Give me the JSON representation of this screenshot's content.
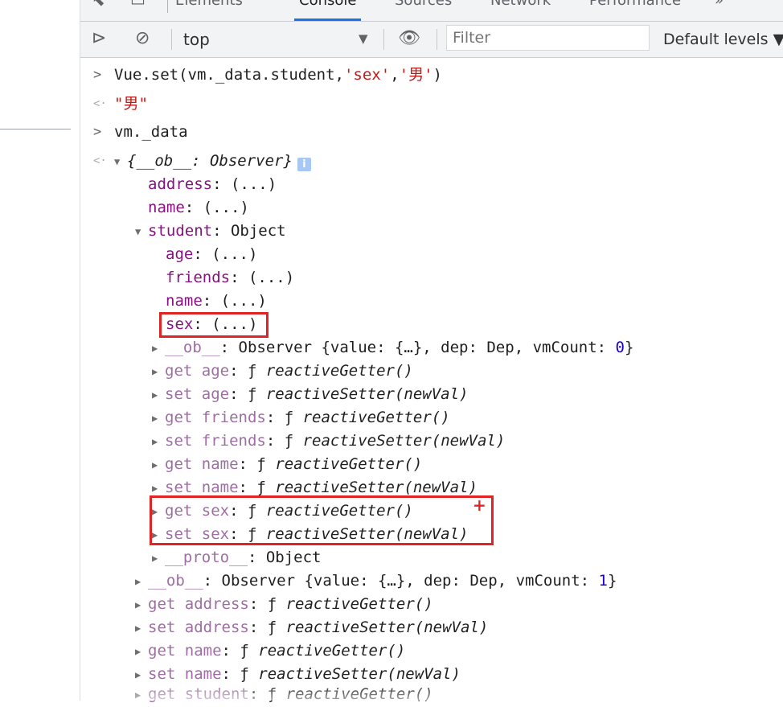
{
  "tabs": [
    {
      "label": "Elements"
    },
    {
      "label": "Console",
      "active": true
    },
    {
      "label": "Sources"
    },
    {
      "label": "Network"
    },
    {
      "label": "Performance"
    },
    {
      "label": "»"
    }
  ],
  "toolbar": {
    "context": "top",
    "filter_placeholder": "Filter",
    "levels": "Default levels"
  },
  "console": {
    "l1": {
      "obj": "Vue.set(vm._data.student,",
      "arg1": "'sex'",
      "comma": ",",
      "arg2": "'男'",
      "close": ")"
    },
    "l2": {
      "value": "\"男\""
    },
    "l3": {
      "text": "vm._data"
    },
    "l4": {
      "text": "{__ob__: Observer}",
      "info": "i"
    },
    "l5": {
      "key": "address",
      "val": ": (...)"
    },
    "l6": {
      "key": "name",
      "val": ": (...)"
    },
    "l7": {
      "key": "student",
      "val": ": Object"
    },
    "l8": {
      "key": "age",
      "val": ": (...)"
    },
    "l9": {
      "key": "friends",
      "val": ": (...)"
    },
    "l10": {
      "key": "name",
      "val": ": (...)"
    },
    "l11": {
      "key": "sex",
      "val": ": (...)"
    },
    "l12": {
      "key": "__ob__",
      "mid": ": Observer {value: {…}, dep: Dep, vmCount: ",
      "num": "0",
      "end": "}"
    },
    "l13": {
      "key": "get age",
      "f": ": ƒ ",
      "fn": "reactiveGetter()"
    },
    "l14": {
      "key": "set age",
      "f": ": ƒ ",
      "fn": "reactiveSetter(newVal)"
    },
    "l15": {
      "key": "get friends",
      "f": ": ƒ ",
      "fn": "reactiveGetter()"
    },
    "l16": {
      "key": "set friends",
      "f": ": ƒ ",
      "fn": "reactiveSetter(newVal)"
    },
    "l17": {
      "key": "get name",
      "f": ": ƒ ",
      "fn": "reactiveGetter()"
    },
    "l18": {
      "key": "set name",
      "f": ": ƒ ",
      "fn": "reactiveSetter(newVal)"
    },
    "l19": {
      "key": "get sex",
      "f": ": ƒ ",
      "fn": "reactiveGetter()"
    },
    "l20": {
      "key": "set sex",
      "f": ": ƒ ",
      "fn": "reactiveSetter(newVal)"
    },
    "l21": {
      "key": "__proto__",
      "val": ": Object"
    },
    "l22": {
      "key": "__ob__",
      "mid": ": Observer {value: {…}, dep: Dep, vmCount: ",
      "num": "1",
      "end": "}"
    },
    "l23": {
      "key": "get address",
      "f": ": ƒ ",
      "fn": "reactiveGetter()"
    },
    "l24": {
      "key": "set address",
      "f": ": ƒ ",
      "fn": "reactiveSetter(newVal)"
    },
    "l25": {
      "key": "get name",
      "f": ": ƒ ",
      "fn": "reactiveGetter()"
    },
    "l26": {
      "key": "set name",
      "f": ": ƒ ",
      "fn": "reactiveSetter(newVal)"
    },
    "l27": {
      "key": "get student",
      "f": ": ƒ ",
      "fn": "reactiveGetter()"
    }
  },
  "annotation": {
    "plus": "+"
  },
  "colors": {
    "highlight": "#e02424",
    "property_key": "#881280",
    "accessor_key": "#9e6ea3",
    "string": "#c41a16",
    "number": "#1c00cf"
  }
}
